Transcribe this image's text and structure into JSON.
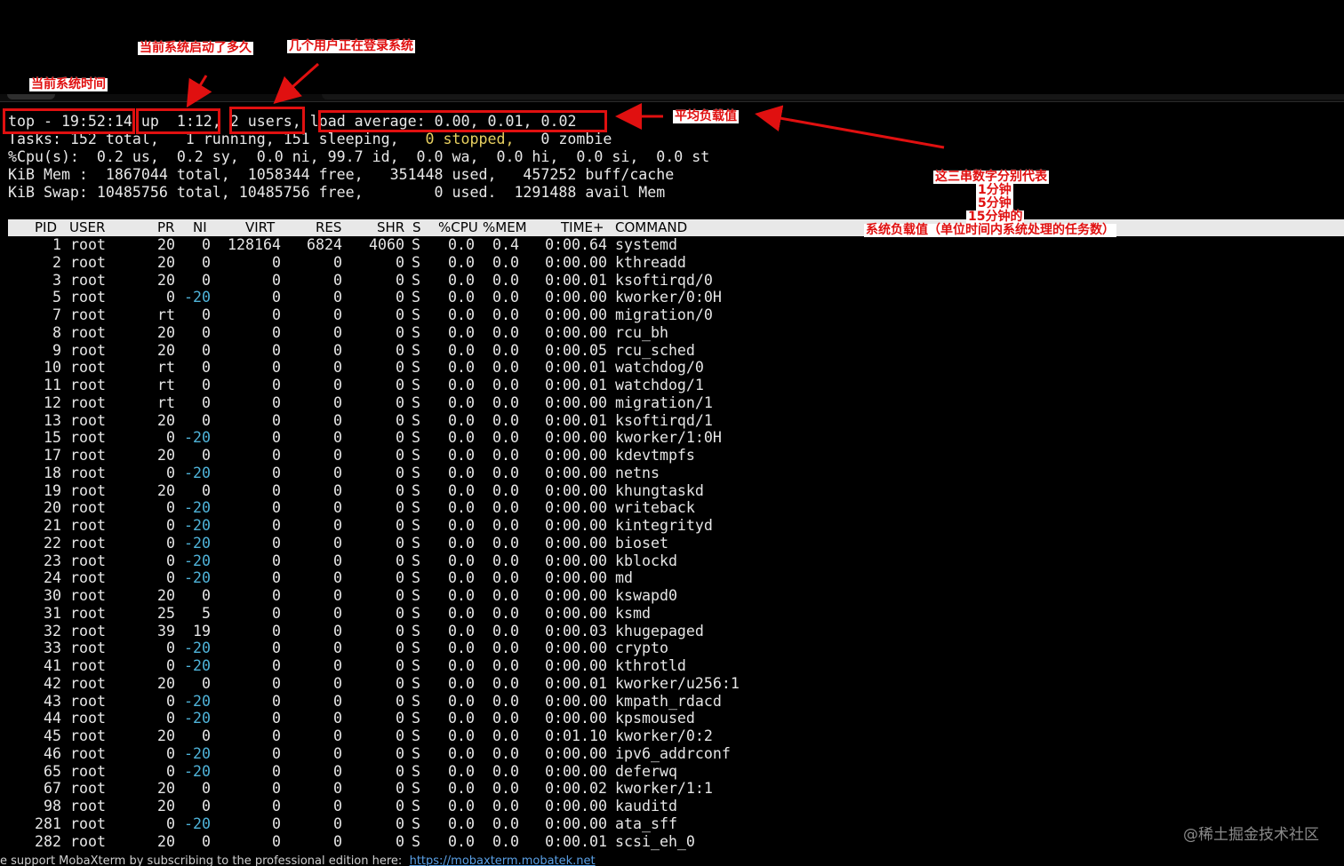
{
  "app": {
    "name": "MobaXterm",
    "footer_text": "e support MobaXterm by subscribing to the professional edition here:",
    "footer_link": "https://mobaxterm.mobatek.net",
    "watermark": "@稀土掘金技术社区"
  },
  "top_summary": {
    "time": "top - 19:52:14",
    "uptime": "up  1:12,",
    "users": "2 users,",
    "load_average": "load average: 0.00, 0.01, 0.02",
    "tasks_pre": "Tasks: 152 total,   1 running, 151 sleeping,   ",
    "tasks_stopped": "0 stopped,",
    "tasks_post": "   0 zombie",
    "cpu": "%Cpu(s):  0.2 us,  0.2 sy,  0.0 ni, 99.7 id,  0.0 wa,  0.0 hi,  0.0 si,  0.0 st",
    "mem": "KiB Mem :  1867044 total,  1058344 free,   351448 used,   457252 buff/cache",
    "swap": "KiB Swap: 10485756 total, 10485756 free,        0 used.  1291488 avail Mem"
  },
  "columns": [
    "PID",
    "USER",
    "PR",
    "NI",
    "VIRT",
    "RES",
    "SHR",
    "S",
    "%CPU",
    "%MEM",
    "TIME+",
    "COMMAND"
  ],
  "processes": [
    {
      "pid": "1",
      "user": "root",
      "pr": "20",
      "ni": "0",
      "virt": "128164",
      "res": "6824",
      "shr": "4060",
      "s": "S",
      "cpu": "0.0",
      "mem": "0.4",
      "time": "0:00.64",
      "cmd": "systemd"
    },
    {
      "pid": "2",
      "user": "root",
      "pr": "20",
      "ni": "0",
      "virt": "0",
      "res": "0",
      "shr": "0",
      "s": "S",
      "cpu": "0.0",
      "mem": "0.0",
      "time": "0:00.00",
      "cmd": "kthreadd"
    },
    {
      "pid": "3",
      "user": "root",
      "pr": "20",
      "ni": "0",
      "virt": "0",
      "res": "0",
      "shr": "0",
      "s": "S",
      "cpu": "0.0",
      "mem": "0.0",
      "time": "0:00.01",
      "cmd": "ksoftirqd/0"
    },
    {
      "pid": "5",
      "user": "root",
      "pr": "0",
      "ni": "-20",
      "virt": "0",
      "res": "0",
      "shr": "0",
      "s": "S",
      "cpu": "0.0",
      "mem": "0.0",
      "time": "0:00.00",
      "cmd": "kworker/0:0H"
    },
    {
      "pid": "7",
      "user": "root",
      "pr": "rt",
      "ni": "0",
      "virt": "0",
      "res": "0",
      "shr": "0",
      "s": "S",
      "cpu": "0.0",
      "mem": "0.0",
      "time": "0:00.00",
      "cmd": "migration/0"
    },
    {
      "pid": "8",
      "user": "root",
      "pr": "20",
      "ni": "0",
      "virt": "0",
      "res": "0",
      "shr": "0",
      "s": "S",
      "cpu": "0.0",
      "mem": "0.0",
      "time": "0:00.00",
      "cmd": "rcu_bh"
    },
    {
      "pid": "9",
      "user": "root",
      "pr": "20",
      "ni": "0",
      "virt": "0",
      "res": "0",
      "shr": "0",
      "s": "S",
      "cpu": "0.0",
      "mem": "0.0",
      "time": "0:00.05",
      "cmd": "rcu_sched"
    },
    {
      "pid": "10",
      "user": "root",
      "pr": "rt",
      "ni": "0",
      "virt": "0",
      "res": "0",
      "shr": "0",
      "s": "S",
      "cpu": "0.0",
      "mem": "0.0",
      "time": "0:00.01",
      "cmd": "watchdog/0"
    },
    {
      "pid": "11",
      "user": "root",
      "pr": "rt",
      "ni": "0",
      "virt": "0",
      "res": "0",
      "shr": "0",
      "s": "S",
      "cpu": "0.0",
      "mem": "0.0",
      "time": "0:00.01",
      "cmd": "watchdog/1"
    },
    {
      "pid": "12",
      "user": "root",
      "pr": "rt",
      "ni": "0",
      "virt": "0",
      "res": "0",
      "shr": "0",
      "s": "S",
      "cpu": "0.0",
      "mem": "0.0",
      "time": "0:00.00",
      "cmd": "migration/1"
    },
    {
      "pid": "13",
      "user": "root",
      "pr": "20",
      "ni": "0",
      "virt": "0",
      "res": "0",
      "shr": "0",
      "s": "S",
      "cpu": "0.0",
      "mem": "0.0",
      "time": "0:00.01",
      "cmd": "ksoftirqd/1"
    },
    {
      "pid": "15",
      "user": "root",
      "pr": "0",
      "ni": "-20",
      "virt": "0",
      "res": "0",
      "shr": "0",
      "s": "S",
      "cpu": "0.0",
      "mem": "0.0",
      "time": "0:00.00",
      "cmd": "kworker/1:0H"
    },
    {
      "pid": "17",
      "user": "root",
      "pr": "20",
      "ni": "0",
      "virt": "0",
      "res": "0",
      "shr": "0",
      "s": "S",
      "cpu": "0.0",
      "mem": "0.0",
      "time": "0:00.00",
      "cmd": "kdevtmpfs"
    },
    {
      "pid": "18",
      "user": "root",
      "pr": "0",
      "ni": "-20",
      "virt": "0",
      "res": "0",
      "shr": "0",
      "s": "S",
      "cpu": "0.0",
      "mem": "0.0",
      "time": "0:00.00",
      "cmd": "netns"
    },
    {
      "pid": "19",
      "user": "root",
      "pr": "20",
      "ni": "0",
      "virt": "0",
      "res": "0",
      "shr": "0",
      "s": "S",
      "cpu": "0.0",
      "mem": "0.0",
      "time": "0:00.00",
      "cmd": "khungtaskd"
    },
    {
      "pid": "20",
      "user": "root",
      "pr": "0",
      "ni": "-20",
      "virt": "0",
      "res": "0",
      "shr": "0",
      "s": "S",
      "cpu": "0.0",
      "mem": "0.0",
      "time": "0:00.00",
      "cmd": "writeback"
    },
    {
      "pid": "21",
      "user": "root",
      "pr": "0",
      "ni": "-20",
      "virt": "0",
      "res": "0",
      "shr": "0",
      "s": "S",
      "cpu": "0.0",
      "mem": "0.0",
      "time": "0:00.00",
      "cmd": "kintegrityd"
    },
    {
      "pid": "22",
      "user": "root",
      "pr": "0",
      "ni": "-20",
      "virt": "0",
      "res": "0",
      "shr": "0",
      "s": "S",
      "cpu": "0.0",
      "mem": "0.0",
      "time": "0:00.00",
      "cmd": "bioset"
    },
    {
      "pid": "23",
      "user": "root",
      "pr": "0",
      "ni": "-20",
      "virt": "0",
      "res": "0",
      "shr": "0",
      "s": "S",
      "cpu": "0.0",
      "mem": "0.0",
      "time": "0:00.00",
      "cmd": "kblockd"
    },
    {
      "pid": "24",
      "user": "root",
      "pr": "0",
      "ni": "-20",
      "virt": "0",
      "res": "0",
      "shr": "0",
      "s": "S",
      "cpu": "0.0",
      "mem": "0.0",
      "time": "0:00.00",
      "cmd": "md"
    },
    {
      "pid": "30",
      "user": "root",
      "pr": "20",
      "ni": "0",
      "virt": "0",
      "res": "0",
      "shr": "0",
      "s": "S",
      "cpu": "0.0",
      "mem": "0.0",
      "time": "0:00.00",
      "cmd": "kswapd0"
    },
    {
      "pid": "31",
      "user": "root",
      "pr": "25",
      "ni": "5",
      "virt": "0",
      "res": "0",
      "shr": "0",
      "s": "S",
      "cpu": "0.0",
      "mem": "0.0",
      "time": "0:00.00",
      "cmd": "ksmd"
    },
    {
      "pid": "32",
      "user": "root",
      "pr": "39",
      "ni": "19",
      "virt": "0",
      "res": "0",
      "shr": "0",
      "s": "S",
      "cpu": "0.0",
      "mem": "0.0",
      "time": "0:00.03",
      "cmd": "khugepaged"
    },
    {
      "pid": "33",
      "user": "root",
      "pr": "0",
      "ni": "-20",
      "virt": "0",
      "res": "0",
      "shr": "0",
      "s": "S",
      "cpu": "0.0",
      "mem": "0.0",
      "time": "0:00.00",
      "cmd": "crypto"
    },
    {
      "pid": "41",
      "user": "root",
      "pr": "0",
      "ni": "-20",
      "virt": "0",
      "res": "0",
      "shr": "0",
      "s": "S",
      "cpu": "0.0",
      "mem": "0.0",
      "time": "0:00.00",
      "cmd": "kthrotld"
    },
    {
      "pid": "42",
      "user": "root",
      "pr": "20",
      "ni": "0",
      "virt": "0",
      "res": "0",
      "shr": "0",
      "s": "S",
      "cpu": "0.0",
      "mem": "0.0",
      "time": "0:00.01",
      "cmd": "kworker/u256:1"
    },
    {
      "pid": "43",
      "user": "root",
      "pr": "0",
      "ni": "-20",
      "virt": "0",
      "res": "0",
      "shr": "0",
      "s": "S",
      "cpu": "0.0",
      "mem": "0.0",
      "time": "0:00.00",
      "cmd": "kmpath_rdacd"
    },
    {
      "pid": "44",
      "user": "root",
      "pr": "0",
      "ni": "-20",
      "virt": "0",
      "res": "0",
      "shr": "0",
      "s": "S",
      "cpu": "0.0",
      "mem": "0.0",
      "time": "0:00.00",
      "cmd": "kpsmoused"
    },
    {
      "pid": "45",
      "user": "root",
      "pr": "20",
      "ni": "0",
      "virt": "0",
      "res": "0",
      "shr": "0",
      "s": "S",
      "cpu": "0.0",
      "mem": "0.0",
      "time": "0:01.10",
      "cmd": "kworker/0:2"
    },
    {
      "pid": "46",
      "user": "root",
      "pr": "0",
      "ni": "-20",
      "virt": "0",
      "res": "0",
      "shr": "0",
      "s": "S",
      "cpu": "0.0",
      "mem": "0.0",
      "time": "0:00.00",
      "cmd": "ipv6_addrconf"
    },
    {
      "pid": "65",
      "user": "root",
      "pr": "0",
      "ni": "-20",
      "virt": "0",
      "res": "0",
      "shr": "0",
      "s": "S",
      "cpu": "0.0",
      "mem": "0.0",
      "time": "0:00.00",
      "cmd": "deferwq"
    },
    {
      "pid": "67",
      "user": "root",
      "pr": "20",
      "ni": "0",
      "virt": "0",
      "res": "0",
      "shr": "0",
      "s": "S",
      "cpu": "0.0",
      "mem": "0.0",
      "time": "0:00.02",
      "cmd": "kworker/1:1"
    },
    {
      "pid": "98",
      "user": "root",
      "pr": "20",
      "ni": "0",
      "virt": "0",
      "res": "0",
      "shr": "0",
      "s": "S",
      "cpu": "0.0",
      "mem": "0.0",
      "time": "0:00.00",
      "cmd": "kauditd"
    },
    {
      "pid": "281",
      "user": "root",
      "pr": "0",
      "ni": "-20",
      "virt": "0",
      "res": "0",
      "shr": "0",
      "s": "S",
      "cpu": "0.0",
      "mem": "0.0",
      "time": "0:00.00",
      "cmd": "ata_sff"
    },
    {
      "pid": "282",
      "user": "root",
      "pr": "20",
      "ni": "0",
      "virt": "0",
      "res": "0",
      "shr": "0",
      "s": "S",
      "cpu": "0.0",
      "mem": "0.0",
      "time": "0:00.01",
      "cmd": "scsi_eh_0"
    }
  ],
  "annotations": {
    "current_time": "当前系统时间",
    "uptime": "当前系统启动了多久",
    "users": "几个用户正在登录系统",
    "load_avg": "平均负载值",
    "three_nums": [
      "这三串数字分别代表",
      "1分钟",
      "5分钟",
      "15分钟的",
      "系统负载值（单位时间内系统处理的任务数）"
    ]
  },
  "colors": {
    "annotation_red": "#e01010",
    "negative_nice": "#4fb3d9",
    "stopped": "#e8d060",
    "header_bg": "#e8e8e8"
  }
}
